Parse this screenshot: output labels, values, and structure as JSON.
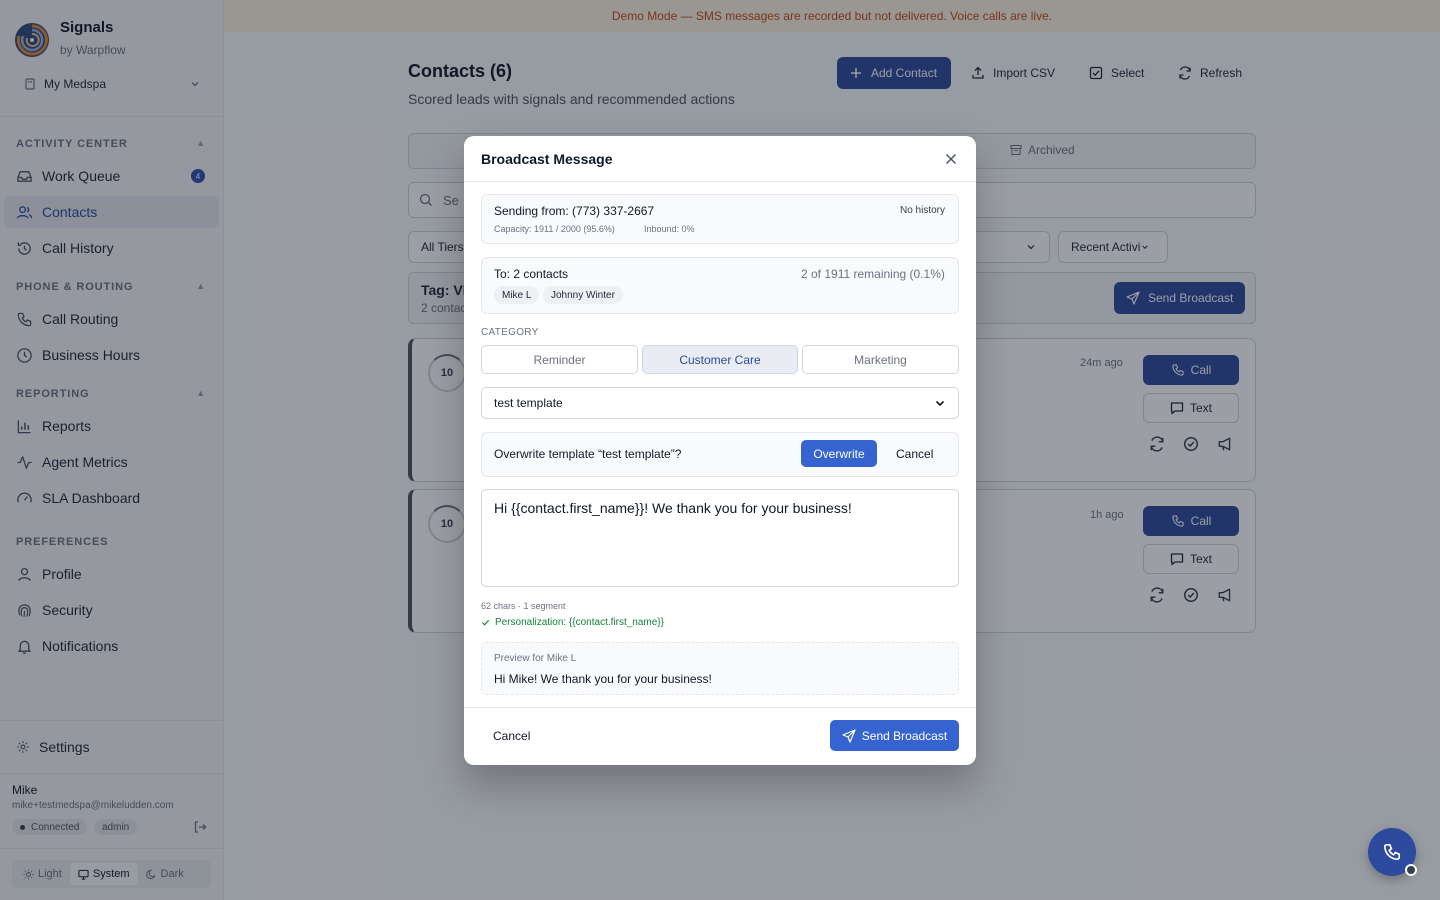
{
  "banner": "Demo Mode — SMS messages are recorded but not delivered. Voice calls are live.",
  "brand": {
    "name": "Signals",
    "sub": "by Warpflow"
  },
  "org": "My Medspa",
  "sidebar": {
    "sections": [
      {
        "label": "ACTIVITY CENTER"
      },
      {
        "label": "PHONE & ROUTING"
      },
      {
        "label": "REPORTING"
      },
      {
        "label": "PREFERENCES"
      }
    ],
    "items": [
      {
        "label": "Work Queue",
        "badge": "4"
      },
      {
        "label": "Contacts"
      },
      {
        "label": "Call History"
      },
      {
        "label": "Call Routing"
      },
      {
        "label": "Business Hours"
      },
      {
        "label": "Reports"
      },
      {
        "label": "Agent Metrics"
      },
      {
        "label": "SLA Dashboard"
      },
      {
        "label": "Profile"
      },
      {
        "label": "Security"
      },
      {
        "label": "Notifications"
      }
    ],
    "settings": "Settings"
  },
  "user": {
    "name": "Mike",
    "email": "mike+testmedspa@mikeludden.com",
    "status": "Connected",
    "role": "admin"
  },
  "theme": {
    "light": "Light",
    "system": "System",
    "dark": "Dark",
    "selected": "System"
  },
  "page": {
    "title": "Contacts (6)",
    "subtitle": "Scored leads with signals and recommended actions",
    "buttons": {
      "add": "Add Contact",
      "import": "Import CSV",
      "select": "Select",
      "refresh": "Refresh"
    },
    "tab_archived": "Archived",
    "search_placeholder": "Se",
    "filter_tiers": "All Tiers",
    "sort": "Recent Activi",
    "tag_title": "Tag: VI",
    "tag_sub": "2 contac",
    "send_broadcast": "Send Broadcast",
    "cards": [
      {
        "score": "10",
        "ago": "24m ago",
        "call": "Call",
        "text": "Text"
      },
      {
        "score": "10",
        "ago": "1h ago",
        "call": "Call",
        "text": "Text"
      }
    ]
  },
  "modal": {
    "title": "Broadcast Message",
    "sending_from": "Sending from: (773) 337-2667",
    "no_history": "No history",
    "capacity": "Capacity: 1911 / 2000 (95.6%)",
    "inbound": "Inbound: 0%",
    "to": "To: 2 contacts",
    "remaining": "2 of 1911 remaining (0.1%)",
    "recipients": [
      "Mike L",
      "Johnny Winter"
    ],
    "category_label": "CATEGORY",
    "categories": [
      "Reminder",
      "Customer Care",
      "Marketing"
    ],
    "category_selected": "Customer Care",
    "template": "test template",
    "overwrite_question": "Overwrite template “test template”?",
    "overwrite": "Overwrite",
    "overwrite_cancel": "Cancel",
    "message": "Hi {{contact.first_name}}! We thank you for your business!",
    "chars": "62 chars · 1 segment",
    "personalization": "Personalization: {{contact.first_name}}",
    "preview_label": "Preview for Mike L",
    "preview_text": "Hi Mike! We thank you for your business!",
    "cancel": "Cancel",
    "send": "Send Broadcast"
  }
}
